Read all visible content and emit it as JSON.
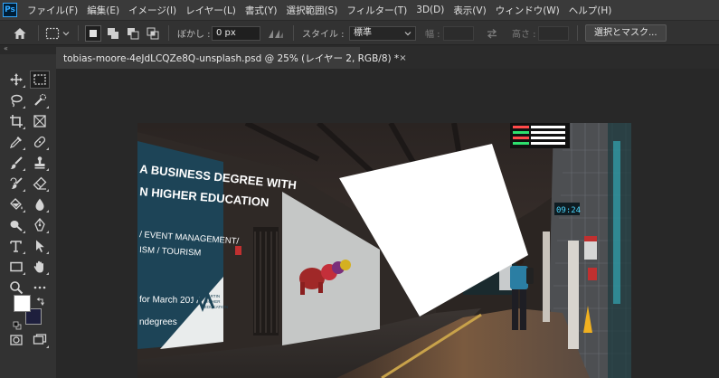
{
  "app": {
    "logo_text": "Ps"
  },
  "menu": [
    "ファイル(F)",
    "編集(E)",
    "イメージ(I)",
    "レイヤー(L)",
    "書式(Y)",
    "選択範囲(S)",
    "フィルター(T)",
    "3D(D)",
    "表示(V)",
    "ウィンドウ(W)",
    "ヘルプ(H)"
  ],
  "options": {
    "feather_label": "ぼかし :",
    "feather_value": "0 px",
    "style_label": "スタイル :",
    "style_value": "標準",
    "width_label": "幅 :",
    "height_label": "高さ :",
    "select_mask_button": "選択とマスク..."
  },
  "document": {
    "tab_title": "tobias-moore-4eJdLCQZe8Q-unsplash.psd @ 25% (レイヤー 2, RGB/8) *",
    "close_glyph": "×"
  },
  "toolbar": {
    "collapse_glyph": "«",
    "tools": [
      "move-tool",
      "rectangular-marquee-tool",
      "lasso-tool",
      "quick-selection-tool",
      "crop-tool",
      "frame-tool",
      "eyedropper-tool",
      "spot-healing-brush-tool",
      "brush-tool",
      "clone-stamp-tool",
      "history-brush-tool",
      "eraser-tool",
      "paint-bucket-tool",
      "blur-tool",
      "dodge-tool",
      "pen-tool",
      "type-tool",
      "path-selection-tool",
      "rectangle-tool",
      "hand-tool",
      "zoom-tool",
      "edit-toolbar"
    ],
    "foreground_color": "#ffffff",
    "background_color": "#1e1f3d"
  },
  "canvas_image": {
    "billboard_left": [
      "A BUSINESS DEGREE WITH",
      "N HIGHER EDUCATION",
      "/ EVENT MANAGEMENT/",
      "ISM / TOURISM",
      "for March 2017",
      "ndegrees"
    ],
    "billboard_logo": [
      "MARTIN",
      "HIGHER",
      "EDUCATION"
    ],
    "sign_clock": "09:24"
  },
  "colors": {
    "accent": "#31a8ff",
    "billboard_teal": "#1d4457",
    "selection_fill": "#ffffff"
  }
}
